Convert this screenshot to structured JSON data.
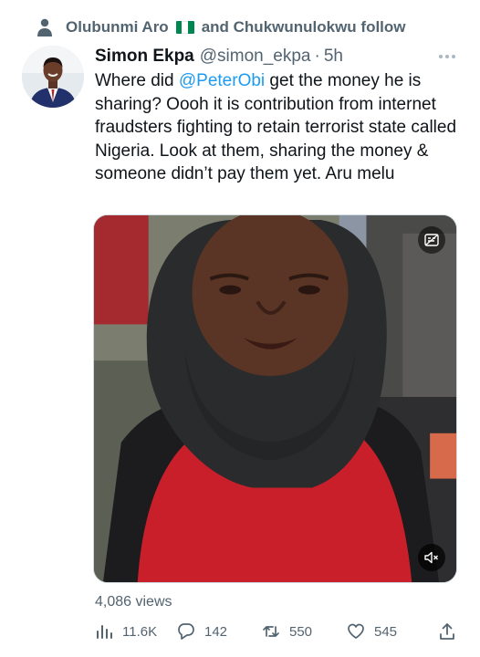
{
  "social_context": {
    "first": "Olubunmi Aro",
    "rest": "and Chukwunulokwu follow",
    "flag_colors": [
      "#008751",
      "#ffffff",
      "#008751"
    ]
  },
  "author": {
    "name": "Simon Ekpa",
    "handle": "@simon_ekpa",
    "separator": "·",
    "time": "5h"
  },
  "tweet": {
    "text_before": "Where did ",
    "mention": "@PeterObi",
    "text_after": " get the money he is sharing? Oooh it is contribution from internet fraudsters fighting to retain terrorist state called Nigeria. Look at them, sharing the money & someone didn’t pay them yet. Aru melu"
  },
  "media": {
    "type": "video",
    "cc_icon": "captions-icon",
    "mute_icon": "muted-speaker-icon"
  },
  "views_label": "4,086 views",
  "actions": {
    "views": "11.6K",
    "replies": "142",
    "retweets": "550",
    "likes": "545"
  },
  "colors": {
    "link": "#1d9bf0",
    "secondary_text": "#536471",
    "primary_text": "#0f1419"
  }
}
